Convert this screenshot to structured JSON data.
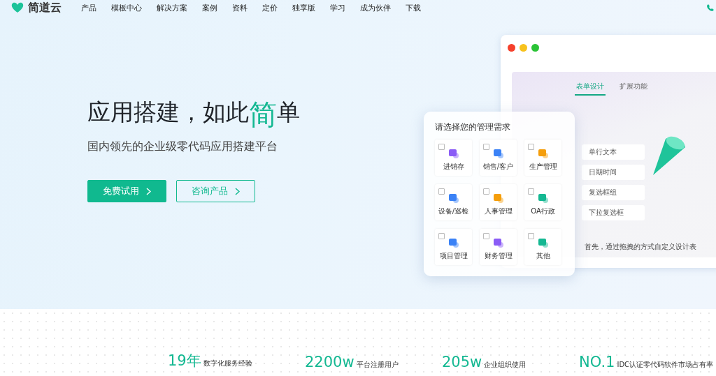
{
  "nav": {
    "brand": "简道云",
    "items": [
      "产品",
      "模板中心",
      "解决方案",
      "案例",
      "资料",
      "定价",
      "独享版",
      "学习",
      "成为伙伴",
      "下载"
    ]
  },
  "hero": {
    "title_before": "应用搭建，如此",
    "title_highlight": "简",
    "title_after": "单",
    "subtitle": "国内领先的企业级零代码应用搭建平台",
    "buttons": [
      {
        "label": "免费试用",
        "kind": "primary"
      },
      {
        "label": "咨询产品",
        "kind": "outline"
      }
    ]
  },
  "selector": {
    "title": "请选择您的管理需求",
    "options": [
      {
        "label": "进销存",
        "checked": false
      },
      {
        "label": "销售/客户",
        "checked": false
      },
      {
        "label": "生产管理",
        "checked": false
      },
      {
        "label": "设备/巡检",
        "checked": false
      },
      {
        "label": "人事管理",
        "checked": false
      },
      {
        "label": "OA行政",
        "checked": false
      },
      {
        "label": "项目管理",
        "checked": false
      },
      {
        "label": "财务管理",
        "checked": false
      },
      {
        "label": "其他",
        "checked": false
      }
    ]
  },
  "mockup": {
    "tabs": [
      {
        "label": "表单设计",
        "selected": true
      },
      {
        "label": "扩展功能",
        "selected": false
      }
    ],
    "fields": [
      "单行文本",
      "日期时间",
      "复选框组",
      "下拉复选框"
    ],
    "caption": "首先，通过拖拽的方式自定义设计表"
  },
  "stats": [
    {
      "value": "19年",
      "label": "数字化服务经验"
    },
    {
      "value": "2200w",
      "label": "平台注册用户"
    },
    {
      "value": "205w",
      "label": "企业组织使用"
    },
    {
      "value": "NO.1",
      "label": "IDC认证零代码软件市场占有率"
    }
  ]
}
